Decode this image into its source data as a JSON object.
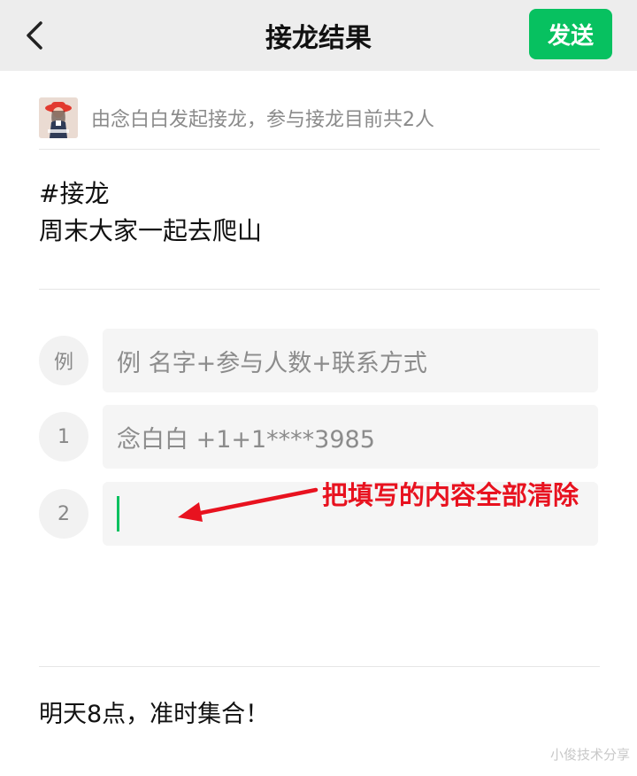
{
  "header": {
    "back_icon": "chevron-left-icon",
    "title": "接龙结果",
    "send_label": "发送",
    "accent_color": "#07c160",
    "bg_color": "#ededed"
  },
  "initiator": {
    "text": "由念白白发起接龙，参与接龙目前共2人"
  },
  "topic": {
    "tag": "#接龙",
    "text": "周末大家一起去爬山"
  },
  "entries": [
    {
      "label": "例",
      "value": "例 名字+参与人数+联系方式"
    },
    {
      "label": "1",
      "value": "念白白 +1+1****3985"
    },
    {
      "label": "2",
      "value": ""
    }
  ],
  "annotation": {
    "text": "把填写的内容全部清除",
    "color": "#e8121f"
  },
  "footer": {
    "text": "明天8点，准时集合！"
  },
  "watermark": {
    "text": "小俊技术分享"
  }
}
